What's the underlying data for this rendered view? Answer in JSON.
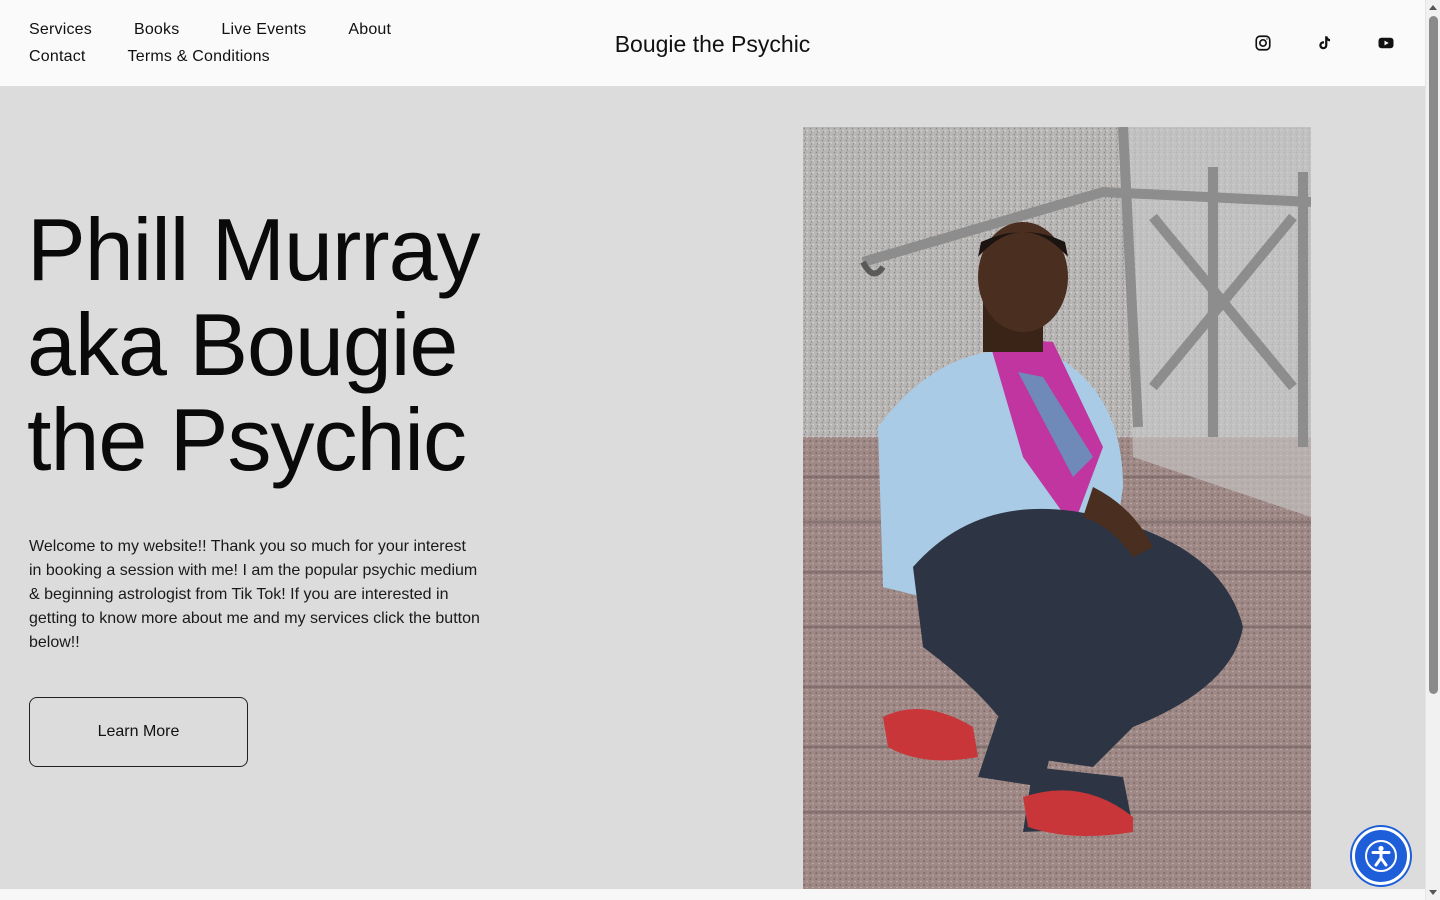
{
  "header": {
    "nav": [
      "Services",
      "Books",
      "Live Events",
      "About",
      "Contact",
      "Terms & Conditions"
    ],
    "site_title": "Bougie the Psychic",
    "social_icons": [
      "instagram-icon",
      "tiktok-icon",
      "youtube-icon"
    ]
  },
  "hero": {
    "title_lines": [
      "Phill Murray",
      "aka Bougie",
      "the Psychic"
    ],
    "body": "Welcome to my website!! Thank you so much for your interest in booking a session with me! I am the popular psychic medium & beginning astrologist from Tik Tok! If you are interested in getting to know more about me and my services click the button below!!",
    "button_label": "Learn More"
  },
  "colors": {
    "header_bg": "#fafafa",
    "section_bg": "#dcdcdc",
    "text": "#111111",
    "accessibility_button": "#1e5fd9"
  }
}
